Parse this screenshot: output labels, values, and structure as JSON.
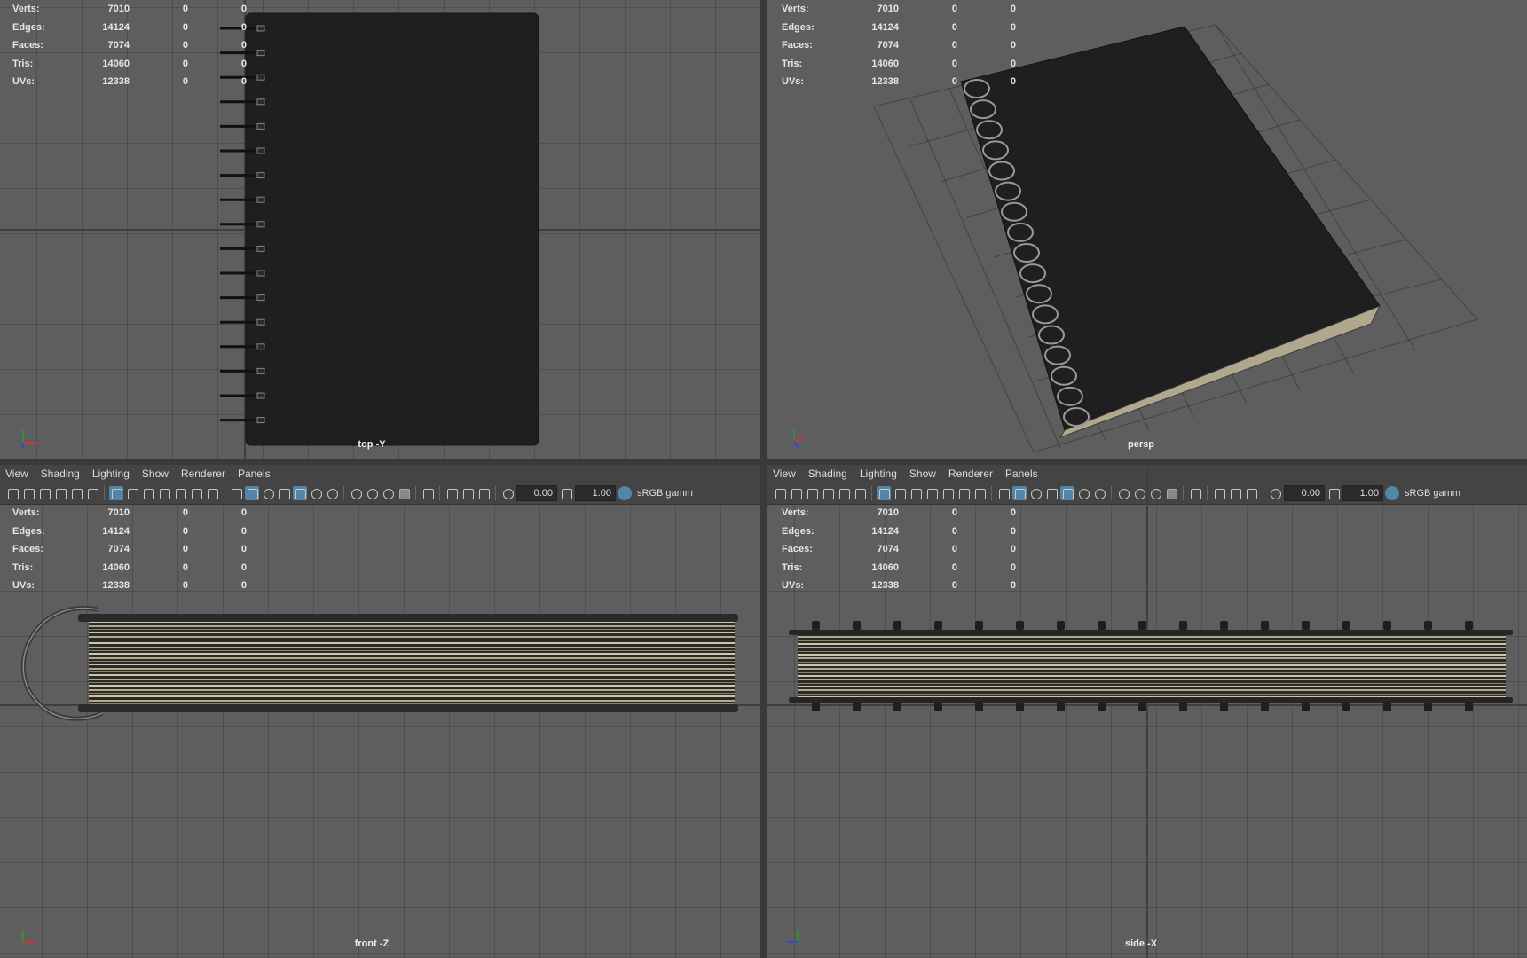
{
  "panels": {
    "top": {
      "label": "top -Y"
    },
    "persp": {
      "label": "persp"
    },
    "front": {
      "label": "front -Z"
    },
    "side": {
      "label": "side -X"
    }
  },
  "hud": {
    "rows": [
      {
        "label": "Verts:",
        "v1": "7010",
        "v2": "0",
        "v3": "0"
      },
      {
        "label": "Edges:",
        "v1": "14124",
        "v2": "0",
        "v3": "0"
      },
      {
        "label": "Faces:",
        "v1": "7074",
        "v2": "0",
        "v3": "0"
      },
      {
        "label": "Tris:",
        "v1": "14060",
        "v2": "0",
        "v3": "0"
      },
      {
        "label": "UVs:",
        "v1": "12338",
        "v2": "0",
        "v3": "0"
      }
    ]
  },
  "menu": {
    "view": "View",
    "shading": "Shading",
    "lighting": "Lighting",
    "show": "Show",
    "renderer": "Renderer",
    "panels": "Panels"
  },
  "toolbar": {
    "exposure": "0.00",
    "gamma": "1.00",
    "colorspace": "sRGB gamm"
  },
  "colors": {
    "viewport_bg": "#5e5e5e",
    "toolbar_bg": "#444444",
    "accent": "#5285a6",
    "cover": "#1f1f1f"
  }
}
